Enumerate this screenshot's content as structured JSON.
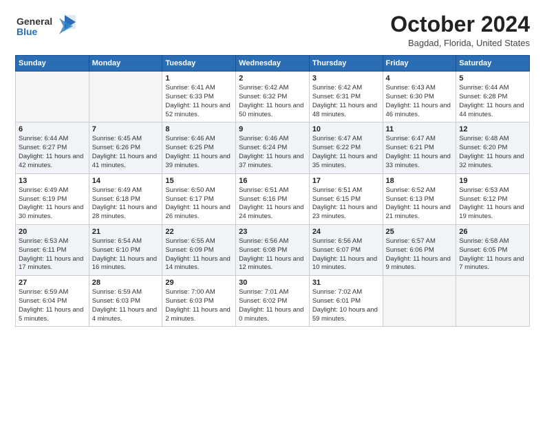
{
  "header": {
    "logo_line1": "General",
    "logo_line2": "Blue",
    "month": "October 2024",
    "location": "Bagdad, Florida, United States"
  },
  "days_of_week": [
    "Sunday",
    "Monday",
    "Tuesday",
    "Wednesday",
    "Thursday",
    "Friday",
    "Saturday"
  ],
  "weeks": [
    [
      {
        "day": "",
        "info": ""
      },
      {
        "day": "",
        "info": ""
      },
      {
        "day": "1",
        "info": "Sunrise: 6:41 AM\nSunset: 6:33 PM\nDaylight: 11 hours and 52 minutes."
      },
      {
        "day": "2",
        "info": "Sunrise: 6:42 AM\nSunset: 6:32 PM\nDaylight: 11 hours and 50 minutes."
      },
      {
        "day": "3",
        "info": "Sunrise: 6:42 AM\nSunset: 6:31 PM\nDaylight: 11 hours and 48 minutes."
      },
      {
        "day": "4",
        "info": "Sunrise: 6:43 AM\nSunset: 6:30 PM\nDaylight: 11 hours and 46 minutes."
      },
      {
        "day": "5",
        "info": "Sunrise: 6:44 AM\nSunset: 6:28 PM\nDaylight: 11 hours and 44 minutes."
      }
    ],
    [
      {
        "day": "6",
        "info": "Sunrise: 6:44 AM\nSunset: 6:27 PM\nDaylight: 11 hours and 42 minutes."
      },
      {
        "day": "7",
        "info": "Sunrise: 6:45 AM\nSunset: 6:26 PM\nDaylight: 11 hours and 41 minutes."
      },
      {
        "day": "8",
        "info": "Sunrise: 6:46 AM\nSunset: 6:25 PM\nDaylight: 11 hours and 39 minutes."
      },
      {
        "day": "9",
        "info": "Sunrise: 6:46 AM\nSunset: 6:24 PM\nDaylight: 11 hours and 37 minutes."
      },
      {
        "day": "10",
        "info": "Sunrise: 6:47 AM\nSunset: 6:22 PM\nDaylight: 11 hours and 35 minutes."
      },
      {
        "day": "11",
        "info": "Sunrise: 6:47 AM\nSunset: 6:21 PM\nDaylight: 11 hours and 33 minutes."
      },
      {
        "day": "12",
        "info": "Sunrise: 6:48 AM\nSunset: 6:20 PM\nDaylight: 11 hours and 32 minutes."
      }
    ],
    [
      {
        "day": "13",
        "info": "Sunrise: 6:49 AM\nSunset: 6:19 PM\nDaylight: 11 hours and 30 minutes."
      },
      {
        "day": "14",
        "info": "Sunrise: 6:49 AM\nSunset: 6:18 PM\nDaylight: 11 hours and 28 minutes."
      },
      {
        "day": "15",
        "info": "Sunrise: 6:50 AM\nSunset: 6:17 PM\nDaylight: 11 hours and 26 minutes."
      },
      {
        "day": "16",
        "info": "Sunrise: 6:51 AM\nSunset: 6:16 PM\nDaylight: 11 hours and 24 minutes."
      },
      {
        "day": "17",
        "info": "Sunrise: 6:51 AM\nSunset: 6:15 PM\nDaylight: 11 hours and 23 minutes."
      },
      {
        "day": "18",
        "info": "Sunrise: 6:52 AM\nSunset: 6:13 PM\nDaylight: 11 hours and 21 minutes."
      },
      {
        "day": "19",
        "info": "Sunrise: 6:53 AM\nSunset: 6:12 PM\nDaylight: 11 hours and 19 minutes."
      }
    ],
    [
      {
        "day": "20",
        "info": "Sunrise: 6:53 AM\nSunset: 6:11 PM\nDaylight: 11 hours and 17 minutes."
      },
      {
        "day": "21",
        "info": "Sunrise: 6:54 AM\nSunset: 6:10 PM\nDaylight: 11 hours and 16 minutes."
      },
      {
        "day": "22",
        "info": "Sunrise: 6:55 AM\nSunset: 6:09 PM\nDaylight: 11 hours and 14 minutes."
      },
      {
        "day": "23",
        "info": "Sunrise: 6:56 AM\nSunset: 6:08 PM\nDaylight: 11 hours and 12 minutes."
      },
      {
        "day": "24",
        "info": "Sunrise: 6:56 AM\nSunset: 6:07 PM\nDaylight: 11 hours and 10 minutes."
      },
      {
        "day": "25",
        "info": "Sunrise: 6:57 AM\nSunset: 6:06 PM\nDaylight: 11 hours and 9 minutes."
      },
      {
        "day": "26",
        "info": "Sunrise: 6:58 AM\nSunset: 6:05 PM\nDaylight: 11 hours and 7 minutes."
      }
    ],
    [
      {
        "day": "27",
        "info": "Sunrise: 6:59 AM\nSunset: 6:04 PM\nDaylight: 11 hours and 5 minutes."
      },
      {
        "day": "28",
        "info": "Sunrise: 6:59 AM\nSunset: 6:03 PM\nDaylight: 11 hours and 4 minutes."
      },
      {
        "day": "29",
        "info": "Sunrise: 7:00 AM\nSunset: 6:03 PM\nDaylight: 11 hours and 2 minutes."
      },
      {
        "day": "30",
        "info": "Sunrise: 7:01 AM\nSunset: 6:02 PM\nDaylight: 11 hours and 0 minutes."
      },
      {
        "day": "31",
        "info": "Sunrise: 7:02 AM\nSunset: 6:01 PM\nDaylight: 10 hours and 59 minutes."
      },
      {
        "day": "",
        "info": ""
      },
      {
        "day": "",
        "info": ""
      }
    ]
  ]
}
